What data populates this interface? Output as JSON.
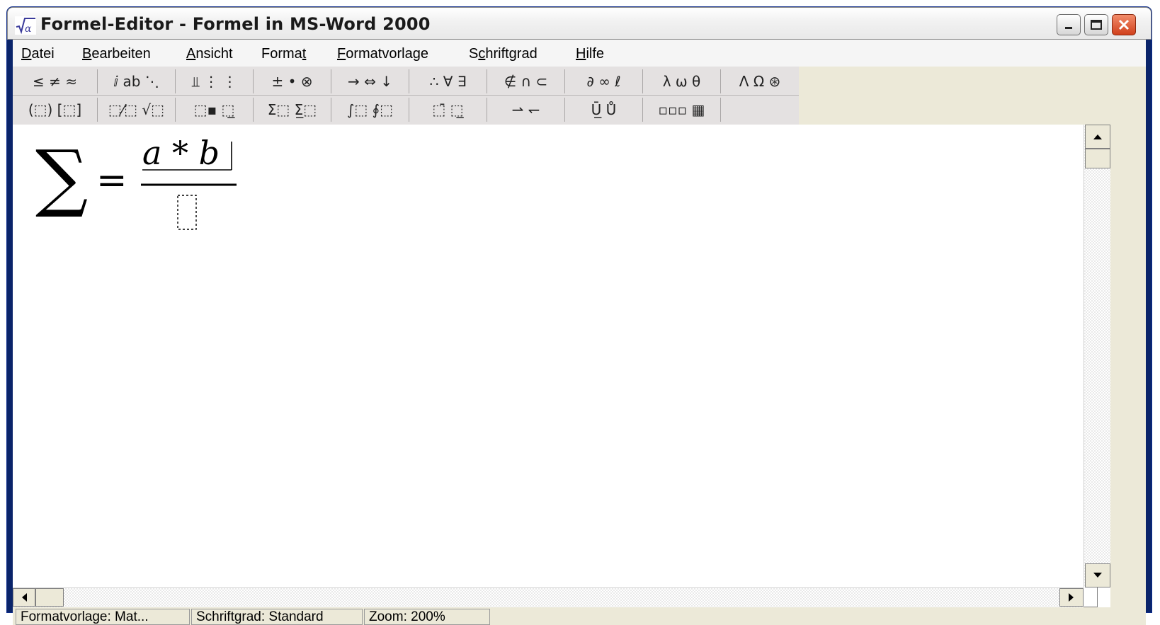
{
  "window": {
    "title": "Formel-Editor - Formel in MS-Word 2000",
    "app_icon_glyph": "√α"
  },
  "menubar": {
    "items": [
      {
        "pre": "",
        "key": "D",
        "post": "atei"
      },
      {
        "pre": "",
        "key": "B",
        "post": "earbeiten"
      },
      {
        "pre": "",
        "key": "A",
        "post": "nsicht"
      },
      {
        "pre": "Forma",
        "key": "t",
        "post": ""
      },
      {
        "pre": "",
        "key": "F",
        "post": "ormatvorlage"
      },
      {
        "pre": "S",
        "key": "c",
        "post": "hriftgrad"
      },
      {
        "pre": "",
        "key": "H",
        "post": "ilfe"
      }
    ]
  },
  "toolbar": {
    "row1": [
      "≤ ≠ ≈",
      "ⅈ ab ⋱",
      "⫫ ⋮ ⋮",
      "± • ⊗",
      "→ ⇔ ↓",
      "∴ ∀ ∃",
      "∉ ∩ ⊂",
      "∂ ∞ ℓ",
      "λ ω θ",
      "Λ Ω ⊛"
    ],
    "row2": [
      "(⬚) [⬚]",
      "⬚⁄⬚ √⬚",
      "⬚▪ ⬚̲",
      "Σ⬚ Σ̲⬚",
      "∫⬚ ∮⬚",
      "⬚̄ ⬚̲",
      "⇀ ↽",
      "Ū̲ Ů",
      "▫▫▫ ▦",
      ""
    ]
  },
  "formula": {
    "sigma": "∑",
    "equals": "=",
    "numerator": "a * b"
  },
  "status": {
    "style": "Formatvorlage: Mat...",
    "size": "Schriftgrad: Standard",
    "zoom": "Zoom: 200%"
  },
  "colors": {
    "title_bar": "#f0f0f0",
    "menubar": "#f5f5f5",
    "toolbar": "#e4e1e1",
    "close_button": "#d9532c",
    "editor_bg": "#ffffff"
  }
}
